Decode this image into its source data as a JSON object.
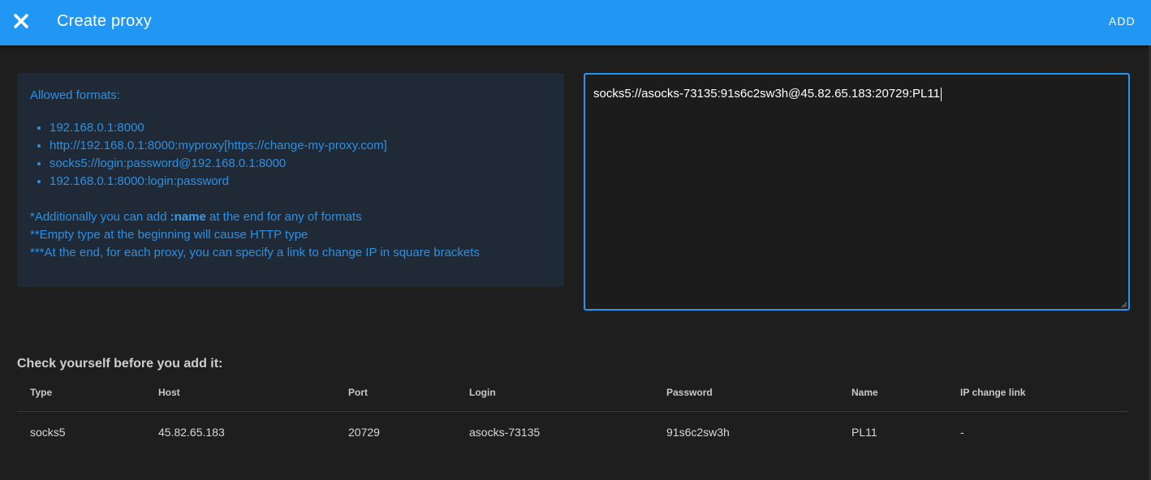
{
  "header": {
    "title": "Create proxy",
    "add_label": "ADD",
    "close_icon": "close-icon",
    "bar_color": "#2196f3"
  },
  "info": {
    "heading": "Allowed formats:",
    "formats": [
      "192.168.0.1:8000",
      "http://192.168.0.1:8000:myproxy[https://change-my-proxy.com]",
      "socks5://login:password@192.168.0.1:8000",
      "192.168.0.1:8000:login:password"
    ],
    "note1_prefix": "*Additionally you can add ",
    "note1_bold": ":name",
    "note1_suffix": " at the end for any of formats",
    "note2": "**Empty type at the beginning will cause HTTP type",
    "note3": "***At the end, for each proxy, you can specify a link to change IP in square brackets"
  },
  "input": {
    "value": "socks5://asocks-73135:91s6c2sw3h@45.82.65.183:20729:PL11"
  },
  "check": {
    "title": "Check yourself before you add it:",
    "columns": [
      "Type",
      "Host",
      "Port",
      "Login",
      "Password",
      "Name",
      "IP change link"
    ],
    "rows": [
      [
        "socks5",
        "45.82.65.183",
        "20729",
        "asocks-73135",
        "91s6c2sw3h",
        "PL11",
        "-"
      ]
    ]
  }
}
